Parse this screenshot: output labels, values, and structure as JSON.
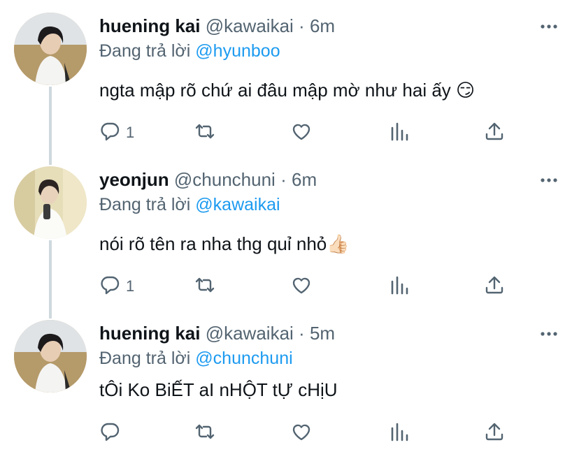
{
  "tweets": [
    {
      "name": "huening kai",
      "handle": "@kawaikai",
      "dot": "·",
      "time": "6m",
      "reply_prefix": "Đang trả lời",
      "reply_to": "@hyunboo",
      "text": "ngta mập rõ chứ ai đâu mập mờ như hai ấy 😏",
      "reply_count": "1",
      "retweet_count": "",
      "like_count": ""
    },
    {
      "name": "yeonjun",
      "handle": "@chunchuni",
      "dot": "·",
      "time": "6m",
      "reply_prefix": "Đang trả lời",
      "reply_to": "@kawaikai",
      "text": "nói rõ tên ra nha thg quỉ nhỏ👍🏻",
      "reply_count": "1",
      "retweet_count": "",
      "like_count": ""
    },
    {
      "name": "huening kai",
      "handle": "@kawaikai",
      "dot": "·",
      "time": "5m",
      "reply_prefix": "Đang trả lời",
      "reply_to": "@chunchuni",
      "text": "tÔi Ko BiẾT aI nHỘT tỰ cHịU",
      "reply_count": "",
      "retweet_count": "",
      "like_count": ""
    }
  ],
  "icons": {
    "reply": "reply-icon",
    "retweet": "retweet-icon",
    "like": "heart-icon",
    "stats": "stats-icon",
    "share": "share-icon",
    "more": "more-icon"
  },
  "colors": {
    "name": "#0f1419",
    "secondary": "#536471",
    "mention": "#1d9bf0",
    "thread_line": "#cfd9de"
  }
}
